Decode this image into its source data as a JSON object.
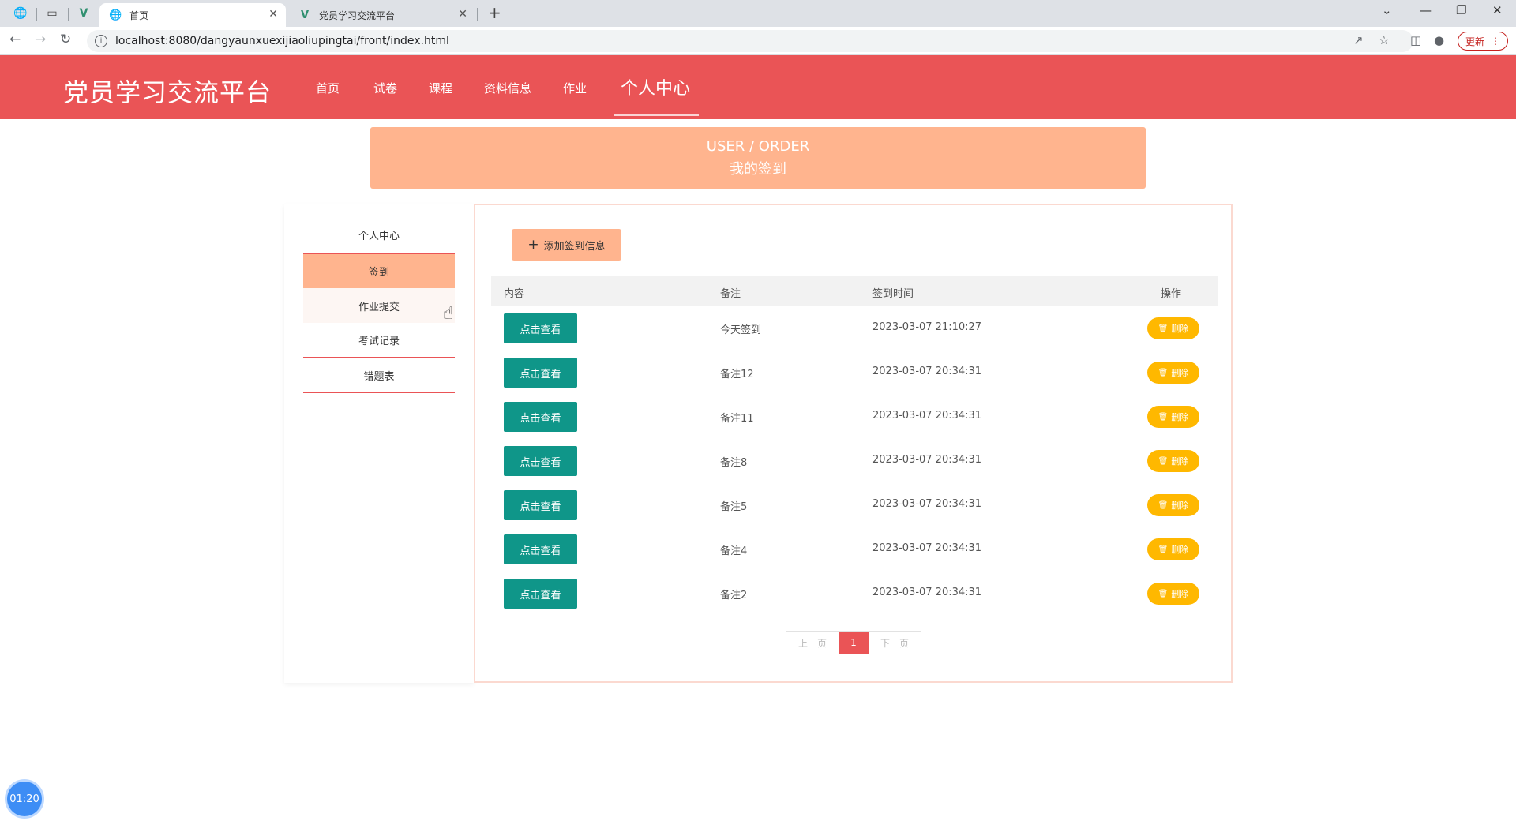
{
  "browser": {
    "tabs": [
      {
        "title": "首页",
        "active": true
      },
      {
        "title": "党员学习交流平台",
        "active": false
      }
    ],
    "url": "localhost:8080/dangyaunxuexijiaoliupingtai/front/index.html",
    "update_label": "更新"
  },
  "site": {
    "title": "党员学习交流平台",
    "nav": [
      "首页",
      "试卷",
      "课程",
      "资料信息",
      "作业",
      "个人中心"
    ],
    "active_nav": "个人中心"
  },
  "banner": {
    "en": "USER / ORDER",
    "zh": "我的签到"
  },
  "sidebar": {
    "items": [
      "个人中心",
      "签到",
      "作业提交",
      "考试记录",
      "错题表"
    ],
    "active": "签到"
  },
  "main": {
    "add_label": "添加签到信息",
    "columns": [
      "内容",
      "备注",
      "签到时间",
      "操作"
    ],
    "view_label": "点击查看",
    "delete_label": "删除",
    "rows": [
      {
        "note": "今天签到",
        "time": "2023-03-07 21:10:27"
      },
      {
        "note": "备注12",
        "time": "2023-03-07 20:34:31"
      },
      {
        "note": "备注11",
        "time": "2023-03-07 20:34:31"
      },
      {
        "note": "备注8",
        "time": "2023-03-07 20:34:31"
      },
      {
        "note": "备注5",
        "time": "2023-03-07 20:34:31"
      },
      {
        "note": "备注4",
        "time": "2023-03-07 20:34:31"
      },
      {
        "note": "备注2",
        "time": "2023-03-07 20:34:31"
      }
    ]
  },
  "pagination": {
    "prev": "上一页",
    "current": "1",
    "next": "下一页"
  },
  "timer": "01:20",
  "colors": {
    "header": "#ea5456",
    "accent": "#ffb48e",
    "view_button": "#0f9689",
    "delete_button": "#ffb800"
  }
}
